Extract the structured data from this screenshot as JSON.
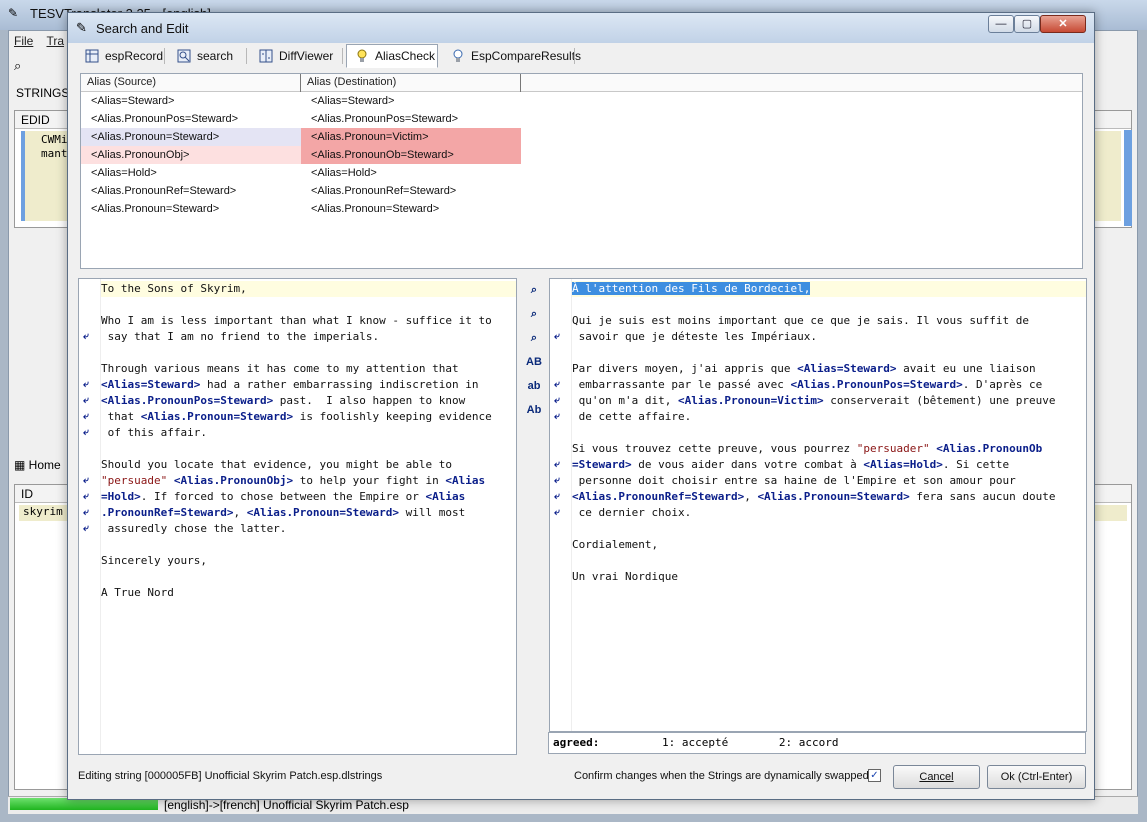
{
  "background": {
    "title": "TESVTranslator 2.25 - [english]",
    "menu": [
      "File",
      "Tra"
    ],
    "strings_label": "STRINGS [",
    "edid_header": "EDID",
    "edid_rows": [
      "CWMi",
      "mant"
    ],
    "home_tab": "Home",
    "id_header": "ID",
    "id_row": "skyrim",
    "status_text": "[english]->[french] Unofficial Skyrim Patch.esp"
  },
  "dialog": {
    "title": "Search and Edit",
    "window_buttons": {
      "minimize": "—",
      "maximize": "▢",
      "close": "✕"
    }
  },
  "tabs": [
    {
      "label": "espRecord",
      "icon": "table-icon"
    },
    {
      "label": "search",
      "icon": "search-list-icon"
    },
    {
      "label": "DiffViewer",
      "icon": "diff-icon"
    },
    {
      "label": "AliasCheck",
      "icon": "lightbulb-icon",
      "active": true
    },
    {
      "label": "EspCompareResults",
      "icon": "lightbulb-icon"
    }
  ],
  "alias_table": {
    "headers": [
      "Alias (Source)",
      "Alias (Destination)"
    ],
    "rows": [
      {
        "source": "<Alias=Steward>",
        "destination": "<Alias=Steward>",
        "status": "ok"
      },
      {
        "source": "<Alias.PronounPos=Steward>",
        "destination": "<Alias.PronounPos=Steward>",
        "status": "ok"
      },
      {
        "source": "<Alias.Pronoun=Steward>",
        "destination": "<Alias.Pronoun=Victim>",
        "status": "mismatch-selected"
      },
      {
        "source": "<Alias.PronounObj>",
        "destination": "<Alias.PronounOb=Steward>",
        "status": "mismatch"
      },
      {
        "source": "<Alias=Hold>",
        "destination": "<Alias=Hold>",
        "status": "ok"
      },
      {
        "source": "<Alias.PronounRef=Steward>",
        "destination": "<Alias.PronounRef=Steward>",
        "status": "ok"
      },
      {
        "source": "<Alias.Pronoun=Steward>",
        "destination": "<Alias.Pronoun=Steward>",
        "status": "ok"
      }
    ]
  },
  "source_text": [
    [
      {
        "t": "To the Sons of Skyrim,"
      }
    ],
    [],
    [
      {
        "t": "Who I am is less important than what I know - suffice it to"
      }
    ],
    [
      {
        "t": " say that I am no friend to the imperials."
      }
    ],
    [],
    [
      {
        "t": "Through various means it has come to my attention that"
      }
    ],
    [
      {
        "t": "<Alias=Steward>",
        "c": "tag"
      },
      {
        "t": " had a rather embarrassing indiscretion in"
      }
    ],
    [
      {
        "t": "<Alias.PronounPos=Steward>",
        "c": "tag"
      },
      {
        "t": " past.  I also happen to know"
      }
    ],
    [
      {
        "t": " that "
      },
      {
        "t": "<Alias.Pronoun=Steward>",
        "c": "tag"
      },
      {
        "t": " is foolishly keeping evidence"
      }
    ],
    [
      {
        "t": " of this affair."
      }
    ],
    [],
    [
      {
        "t": "Should you locate that evidence, you might be able to"
      }
    ],
    [
      {
        "t": "\"persuade\"",
        "c": "str"
      },
      {
        "t": " "
      },
      {
        "t": "<Alias.PronounObj>",
        "c": "tag"
      },
      {
        "t": " to help your fight in "
      },
      {
        "t": "<Alias",
        "c": "tag"
      }
    ],
    [
      {
        "t": "=Hold>",
        "c": "tag"
      },
      {
        "t": ". If forced to chose between the Empire or "
      },
      {
        "t": "<Alias",
        "c": "tag"
      }
    ],
    [
      {
        "t": ".PronounRef=Steward>",
        "c": "tag"
      },
      {
        "t": ", "
      },
      {
        "t": "<Alias.Pronoun=Steward>",
        "c": "tag"
      },
      {
        "t": " will most"
      }
    ],
    [
      {
        "t": " assuredly chose the latter."
      }
    ],
    [],
    [
      {
        "t": "Sincerely yours,"
      }
    ],
    [],
    [
      {
        "t": "A True Nord"
      }
    ]
  ],
  "source_wrap_lines": [
    3,
    6,
    7,
    8,
    9,
    12,
    13,
    14,
    15
  ],
  "dest_text": [
    [
      {
        "t": "À l'attention des Fils de Bordeciel,",
        "c": "hl"
      }
    ],
    [],
    [
      {
        "t": "Qui je suis est moins important que ce que je sais. Il vous suffit de"
      }
    ],
    [
      {
        "t": " savoir que je déteste les Impériaux."
      }
    ],
    [],
    [
      {
        "t": "Par divers moyen, j'ai appris que "
      },
      {
        "t": "<Alias=Steward>",
        "c": "tag"
      },
      {
        "t": " avait eu une liaison"
      }
    ],
    [
      {
        "t": " embarrassante par le passé avec "
      },
      {
        "t": "<Alias.PronounPos=Steward>",
        "c": "tag"
      },
      {
        "t": ". D'après ce"
      }
    ],
    [
      {
        "t": " qu'on m'a dit, "
      },
      {
        "t": "<Alias.Pronoun=Victim>",
        "c": "tag"
      },
      {
        "t": " conserverait (bêtement) une preuve"
      }
    ],
    [
      {
        "t": " de cette affaire."
      }
    ],
    [],
    [
      {
        "t": "Si vous trouvez cette preuve, vous pourrez "
      },
      {
        "t": "\"persuader\"",
        "c": "str"
      },
      {
        "t": " "
      },
      {
        "t": "<Alias.PronounOb",
        "c": "tag"
      }
    ],
    [
      {
        "t": "=Steward>",
        "c": "tag"
      },
      {
        "t": " de vous aider dans votre combat à "
      },
      {
        "t": "<Alias=Hold>",
        "c": "tag"
      },
      {
        "t": ". Si cette"
      }
    ],
    [
      {
        "t": " personne doit choisir entre sa haine de l'Empire et son amour pour"
      }
    ],
    [
      {
        "t": "<Alias.PronounRef=Steward>",
        "c": "tag"
      },
      {
        "t": ", "
      },
      {
        "t": "<Alias.Pronoun=Steward>",
        "c": "tag"
      },
      {
        "t": " fera sans aucun doute"
      }
    ],
    [
      {
        "t": " ce dernier choix."
      }
    ],
    [],
    [
      {
        "t": "Cordialement,"
      }
    ],
    [],
    [
      {
        "t": "Un vrai Nordique"
      }
    ]
  ],
  "dest_wrap_lines": [
    3,
    6,
    7,
    8,
    11,
    12,
    13,
    14
  ],
  "mid_toolbar": [
    {
      "icon": "search-icon",
      "glyph": "⌕"
    },
    {
      "icon": "find-prev-icon",
      "glyph": "⌕"
    },
    {
      "icon": "find-next-icon",
      "glyph": "⌕"
    },
    {
      "icon": "uppercase-icon",
      "glyph": "AB"
    },
    {
      "icon": "lowercase-icon",
      "glyph": "ab"
    },
    {
      "icon": "capitalize-icon",
      "glyph": "Ab"
    }
  ],
  "glossary": {
    "term": "agreed:",
    "options": [
      "1: accepté",
      "2: accord"
    ]
  },
  "footer": {
    "status": "Editing string [000005FB] Unofficial Skyrim Patch.esp.dlstrings",
    "confirm_label": "Confirm changes when the Strings are dynamically swapped",
    "confirm_checked": true,
    "cancel_label": "Cancel",
    "ok_label": "Ok (Ctrl-Enter)"
  },
  "colors": {
    "mismatch_source": "#fde0e0",
    "mismatch_dest": "#f3a6a6",
    "selected_source": "#e4e4f4",
    "tag": "#0a1e8a",
    "string": "#8a1414",
    "selection": "#3d8ee0"
  }
}
